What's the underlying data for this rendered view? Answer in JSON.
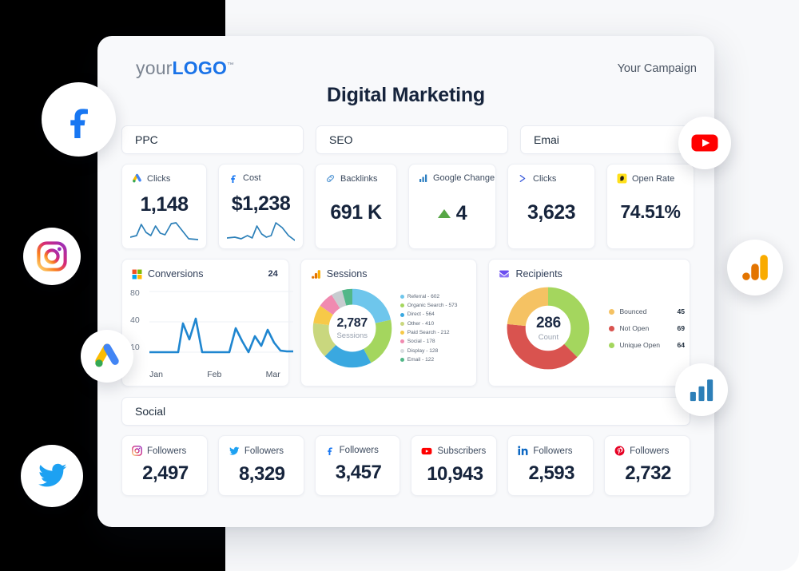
{
  "header": {
    "logo_your": "your",
    "logo_brand": "LOGO",
    "logo_tm": "™",
    "campaign": "Your Campaign",
    "title": "Digital Marketing"
  },
  "sections": {
    "ppc": "PPC",
    "seo": "SEO",
    "email": "Emai",
    "social": "Social"
  },
  "kpis": [
    {
      "icon": "google-ads-icon",
      "label": "Clicks",
      "value": "1,148"
    },
    {
      "icon": "facebook-icon",
      "label": "Cost",
      "value": "$1,238"
    },
    {
      "icon": "link-chain-icon",
      "label": "Backlinks",
      "value": "691 K"
    },
    {
      "icon": "bar-chart-icon",
      "label": "Google Change",
      "value": "4",
      "delta": "up"
    },
    {
      "icon": "send-chevron-icon",
      "label": "Clicks",
      "value": "3,623"
    },
    {
      "icon": "mailchimp-icon",
      "label": "Open Rate",
      "value": "74.51%"
    }
  ],
  "social_cards": [
    {
      "icon": "instagram-icon",
      "label": "Followers",
      "value": "2,497"
    },
    {
      "icon": "twitter-icon",
      "label": "Followers",
      "value": "8,329"
    },
    {
      "icon": "facebook-icon",
      "label": "Followers",
      "value": "3,457"
    },
    {
      "icon": "youtube-icon",
      "label": "Subscribers",
      "value": "10,943"
    },
    {
      "icon": "linkedin-icon",
      "label": "Followers",
      "value": "2,593"
    },
    {
      "icon": "pinterest-icon",
      "label": "Followers",
      "value": "2,732"
    }
  ],
  "floating_badges": [
    {
      "name": "facebook-badge",
      "icon": "facebook-icon"
    },
    {
      "name": "instagram-badge",
      "icon": "instagram-icon"
    },
    {
      "name": "google-ads-badge",
      "icon": "google-ads-icon"
    },
    {
      "name": "twitter-badge",
      "icon": "twitter-icon"
    },
    {
      "name": "youtube-badge",
      "icon": "youtube-icon"
    },
    {
      "name": "google-analytics-badge",
      "icon": "analytics-orange-icon"
    },
    {
      "name": "search-console-badge",
      "icon": "bar-chart-blue-icon"
    }
  ],
  "chart_data": [
    {
      "type": "line",
      "title": "Conversions",
      "icon": "microsoft-squares-icon",
      "badge_value": "24",
      "xlabel": "",
      "ylabel": "",
      "ylim": [
        0,
        90
      ],
      "yticks": [
        "80",
        "40",
        "10"
      ],
      "categories": [
        "Jan",
        "Feb",
        "Mar"
      ],
      "x_tick_labels": [
        "Jan",
        "Feb",
        "Mar"
      ],
      "grid": true,
      "series": [
        {
          "name": "Conversions",
          "color": "#1f86d0",
          "values": [
            10,
            10,
            10,
            10,
            10,
            10,
            38,
            22,
            45,
            10,
            10,
            10,
            10,
            10,
            34,
            18,
            10,
            24,
            14,
            31,
            12
          ]
        }
      ]
    },
    {
      "type": "pie",
      "title": "Sessions",
      "icon": "google-analytics-icon",
      "center_value": "2,787",
      "center_label": "Sessions",
      "legend_position": "right",
      "labels": [
        "Referral",
        "Organic Search",
        "Direct",
        "Other",
        "Paid Search",
        "Social",
        "Display",
        "Email"
      ],
      "values": [
        602,
        573,
        564,
        410,
        212,
        178,
        128,
        122
      ],
      "colors": [
        "#6ec6ec",
        "#a4d65e",
        "#3aa8e0",
        "#c9d77e",
        "#f7c948",
        "#f08ab0",
        "#d9dde0",
        "#52b788"
      ],
      "legend_entries": [
        {
          "label": "Referral",
          "value": "602",
          "color": "#6ec6ec"
        },
        {
          "label": "Organic Search",
          "value": "573",
          "color": "#a4d65e"
        },
        {
          "label": "Direct",
          "value": "564",
          "color": "#3aa8e0"
        },
        {
          "label": "Other",
          "value": "410",
          "color": "#c9d77e"
        },
        {
          "label": "Paid Search",
          "value": "212",
          "color": "#f7c948"
        },
        {
          "label": "Social",
          "value": "178",
          "color": "#f08ab0"
        },
        {
          "label": "Display",
          "value": "128",
          "color": "#d9dde0"
        },
        {
          "label": "Email",
          "value": "122",
          "color": "#52b788"
        }
      ]
    },
    {
      "type": "pie",
      "title": "Recipients",
      "icon": "mail-purple-icon",
      "center_value": "286",
      "center_label": "Count",
      "legend_position": "right",
      "labels": [
        "Bounced",
        "Not Open",
        "Unique Open"
      ],
      "values": [
        45,
        69,
        64
      ],
      "colors": [
        "#f5c263",
        "#d9534f",
        "#a4d65e"
      ],
      "legend_entries": [
        {
          "label": "Bounced",
          "value": "45",
          "color": "#f5c263"
        },
        {
          "label": "Not Open",
          "value": "69",
          "color": "#d9534f"
        },
        {
          "label": "Unique Open",
          "value": "64",
          "color": "#a4d65e"
        }
      ]
    }
  ],
  "colors": {
    "accent_blue": "#1a73e8",
    "line_blue": "#1f86d0",
    "green_up": "#56a645",
    "card_bg": "#ffffff",
    "page_bg": "#f8f9fb",
    "backdrop": "#000000"
  }
}
